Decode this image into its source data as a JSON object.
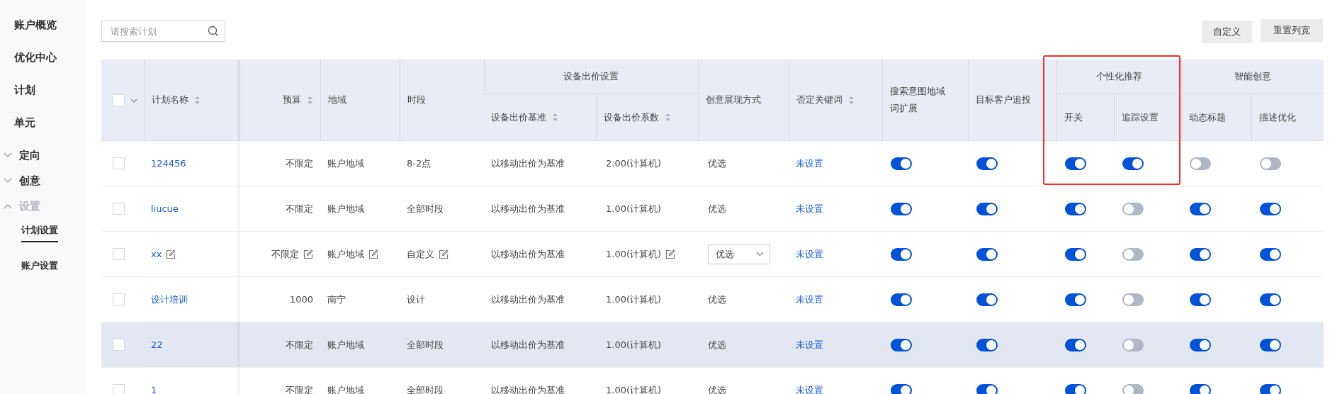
{
  "sidebar": {
    "items": [
      {
        "label": "账户概览",
        "kind": "link"
      },
      {
        "label": "优化中心",
        "kind": "link"
      },
      {
        "label": "计划",
        "kind": "link"
      },
      {
        "label": "单元",
        "kind": "link"
      },
      {
        "label": "定向",
        "kind": "group",
        "expanded": false
      },
      {
        "label": "创意",
        "kind": "group",
        "expanded": false
      },
      {
        "label": "设置",
        "kind": "group",
        "expanded": true,
        "children": [
          {
            "label": "计划设置",
            "selected": true
          },
          {
            "label": "账户设置",
            "selected": false
          }
        ]
      }
    ]
  },
  "search": {
    "placeholder": "请搜索计划"
  },
  "buttons": [
    "自定义",
    "重置列宽"
  ],
  "table": {
    "columns": [
      {
        "kind": "select",
        "checked": false
      },
      {
        "label": "计划名称",
        "sortable": true
      },
      {
        "label": "预算",
        "sortable": true
      },
      {
        "label": "地域"
      },
      {
        "label": "时段"
      },
      {
        "label": "设备出价设置",
        "colspan": 2,
        "children": [
          {
            "label": "设备出价基准",
            "sortable": true
          },
          {
            "label": "设备出价系数",
            "sortable": true
          }
        ]
      },
      {
        "label": "创意展现方式"
      },
      {
        "label": "否定关键词",
        "sortable": true
      },
      {
        "label": "搜索意图地域词扩展"
      },
      {
        "label": "目标客户追投"
      },
      {
        "label": "个性化推荐",
        "colspan": 2,
        "highlighted": true,
        "children": [
          {
            "label": "开关"
          },
          {
            "label": "追踪设置"
          }
        ]
      },
      {
        "label": "智能创意",
        "colspan": 2,
        "children": [
          {
            "label": "动态标题"
          },
          {
            "label": "描述优化"
          }
        ]
      }
    ],
    "rows": [
      {
        "checked": false,
        "editable": false,
        "highlighted": false,
        "cells": [
          "",
          "124456",
          "不限定",
          "账户地域",
          "8-2点",
          "以移动出价为基准",
          "2.00(计算机)",
          "优选",
          "未设置"
        ],
        "toggles": [
          true,
          true,
          true,
          true,
          false,
          false
        ]
      },
      {
        "checked": false,
        "editable": false,
        "highlighted": false,
        "cells": [
          "",
          "liucue",
          "不限定",
          "账户地域",
          "全部时段",
          "以移动出价为基准",
          "1.00(计算机)",
          "优选",
          "未设置"
        ],
        "toggles": [
          true,
          true,
          true,
          false,
          true,
          true
        ]
      },
      {
        "checked": false,
        "editable": true,
        "highlighted": false,
        "cells": [
          "",
          "xx",
          "不限定",
          "账户地域",
          "自定义",
          "以移动出价为基准",
          "1.00(计算机)",
          "优选",
          "未设置"
        ],
        "toggles": [
          true,
          true,
          true,
          false,
          true,
          true
        ]
      },
      {
        "checked": false,
        "editable": false,
        "highlighted": false,
        "cells": [
          "",
          "设计培训",
          "1000",
          "南宁",
          "设计",
          "以移动出价为基准",
          "1.00(计算机)",
          "优选",
          "未设置"
        ],
        "toggles": [
          true,
          true,
          true,
          false,
          true,
          true
        ]
      },
      {
        "checked": false,
        "editable": false,
        "highlighted": true,
        "cells": [
          "",
          "22",
          "不限定",
          "账户地域",
          "全部时段",
          "以移动出价为基准",
          "1.00(计算机)",
          "优选",
          "未设置"
        ],
        "toggles": [
          true,
          true,
          true,
          false,
          true,
          true
        ]
      },
      {
        "checked": false,
        "editable": false,
        "highlighted": false,
        "cells": [
          "",
          "1",
          "不限定",
          "账户地域",
          "全部时段",
          "以移动出价为基准",
          "1.00(计算机)",
          "优选",
          "未设置"
        ],
        "toggles": [
          true,
          true,
          true,
          false,
          true,
          true
        ]
      }
    ]
  }
}
